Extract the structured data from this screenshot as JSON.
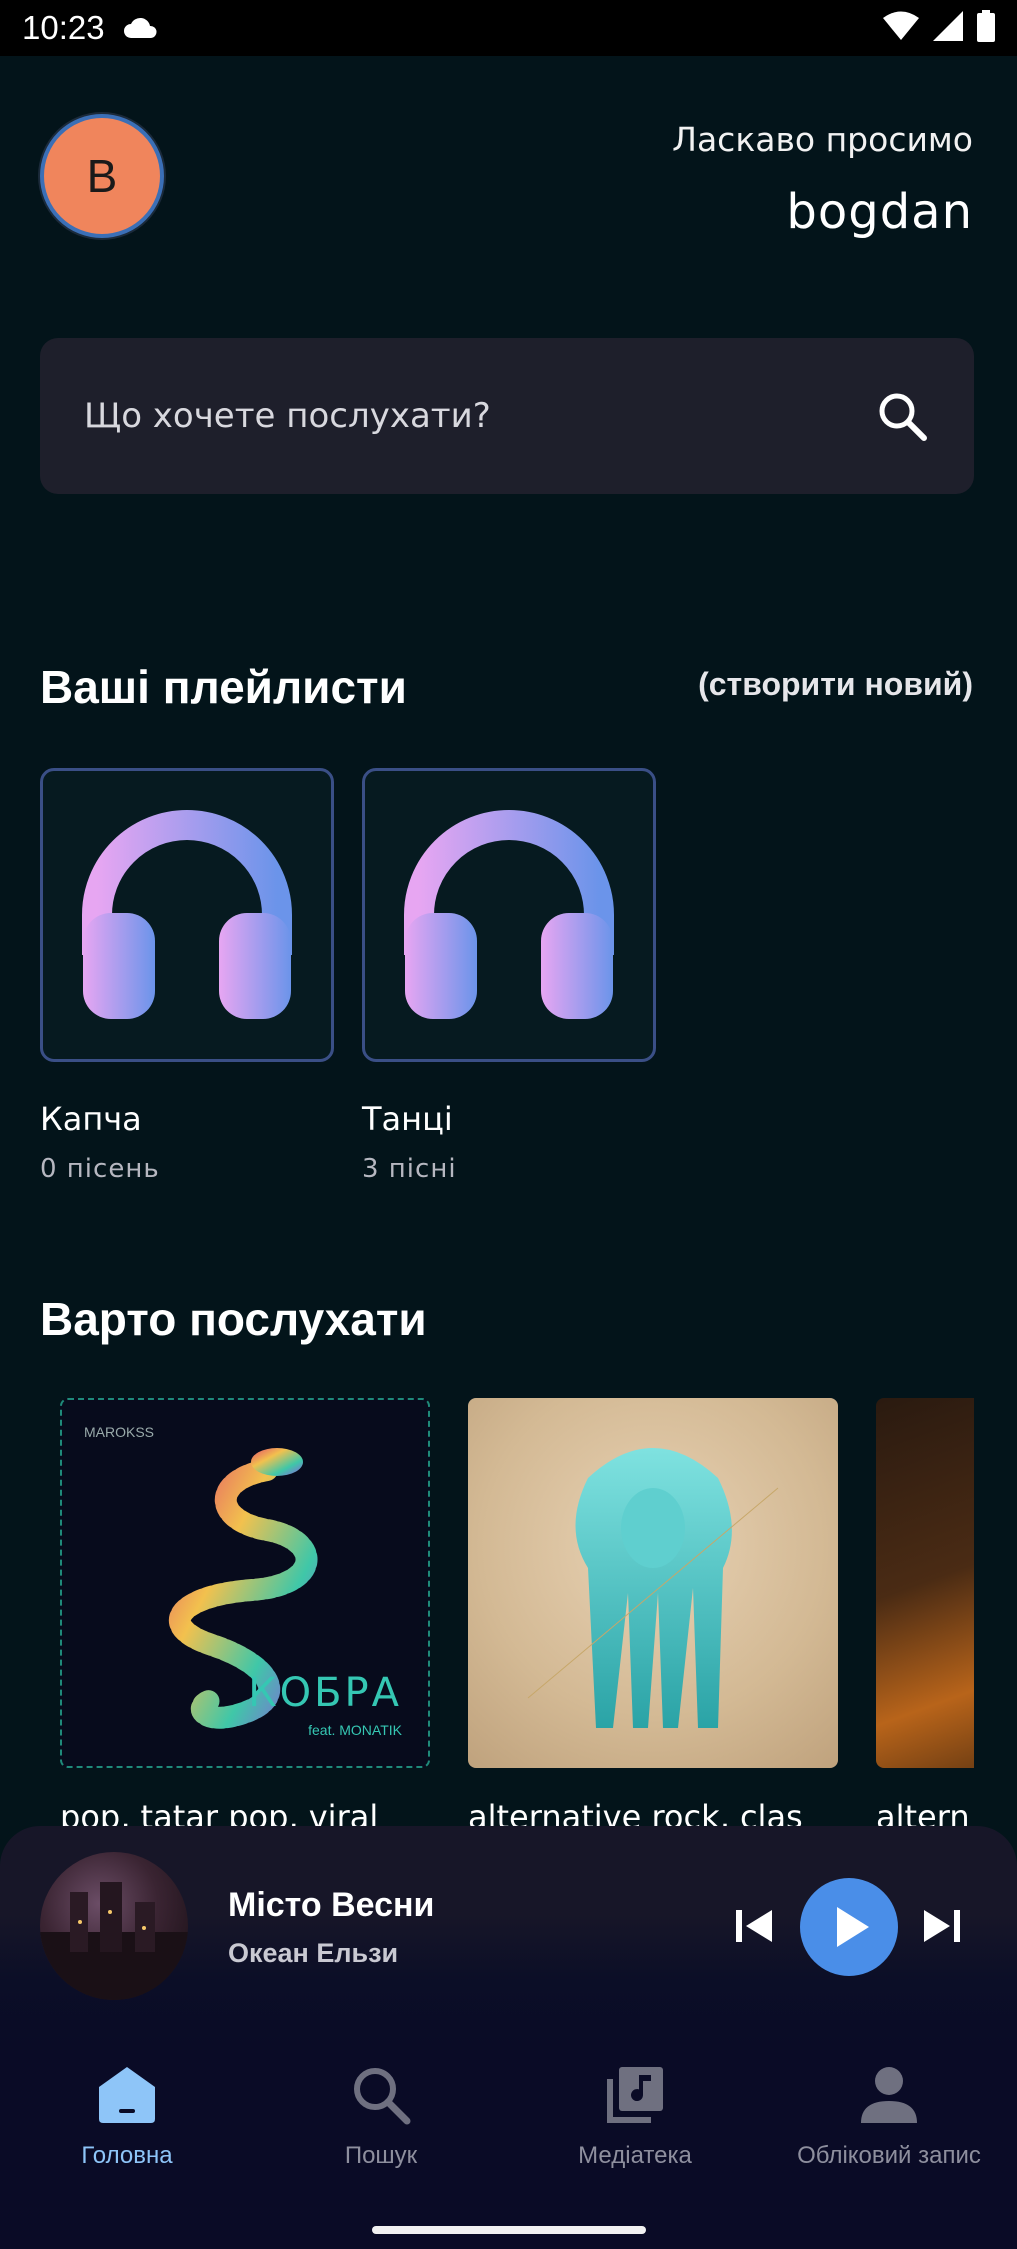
{
  "status_bar": {
    "time": "10:23"
  },
  "header": {
    "avatar_initial": "B",
    "welcome": "Ласкаво просимо",
    "username": "bogdan"
  },
  "search": {
    "placeholder": "Що хочете послухати?"
  },
  "playlists": {
    "title": "Ваші плейлисти",
    "create_label": "(створити новий)",
    "items": [
      {
        "name": "Капча",
        "count": "0 пісень"
      },
      {
        "name": "Танці",
        "count": "3 пісні"
      }
    ]
  },
  "recommended": {
    "title": "Варто послухати",
    "items": [
      {
        "label": "pop, tatar pop, viral",
        "cover_text": "КОБРА",
        "cover_subtext": "feat. MONATIK",
        "cover_brand": "MAROKSS"
      },
      {
        "label": "alternative rock, clas"
      },
      {
        "label": "altern"
      }
    ]
  },
  "now_playing": {
    "title": "Місто Весни",
    "artist": "Океан Ельзи"
  },
  "nav": {
    "items": [
      {
        "label": "Головна",
        "active": true
      },
      {
        "label": "Пошук",
        "active": false
      },
      {
        "label": "Медіатека",
        "active": false
      },
      {
        "label": "Обліковий запис",
        "active": false
      }
    ]
  },
  "colors": {
    "background": "#03141a",
    "accent": "#4a8ee8",
    "avatar": "#f0855c",
    "nav_active": "#8ec5f8"
  }
}
